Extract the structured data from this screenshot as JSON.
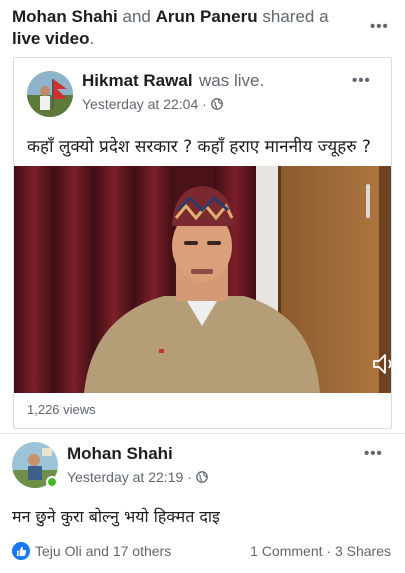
{
  "share_header": {
    "sharer1": "Mohan Shahi",
    "connector": "and",
    "sharer2": "Arun Paneru",
    "action": "shared a",
    "object": "live video",
    "period": "."
  },
  "shared_post": {
    "author": "Hikmat Rawal",
    "status": "was live.",
    "time": "Yesterday at 22:04",
    "separator": "·",
    "text": "कहाँ लुक्यो प्रदेश सरकार ? कहाँ हराए माननीय ज्यूहरु ?",
    "views": "1,226 views"
  },
  "comment_post": {
    "author": "Mohan Shahi",
    "time": "Yesterday at 22:19",
    "separator": "·",
    "text": "मन छुने कुरा बोल्नु भयो हिक्मत दाइ"
  },
  "footer": {
    "reactions": "Teju Oli and 17 others",
    "comments": "1 Comment",
    "separator": "·",
    "shares": "3 Shares"
  },
  "menu_glyph": "•••",
  "icons": {
    "more": "more-options-icon",
    "globe": "globe-icon",
    "volume": "volume-icon",
    "like": "like-icon"
  },
  "colors": {
    "facebook_blue": "#1877f2",
    "online_green": "#42b72a",
    "muted_text": "#606770"
  }
}
